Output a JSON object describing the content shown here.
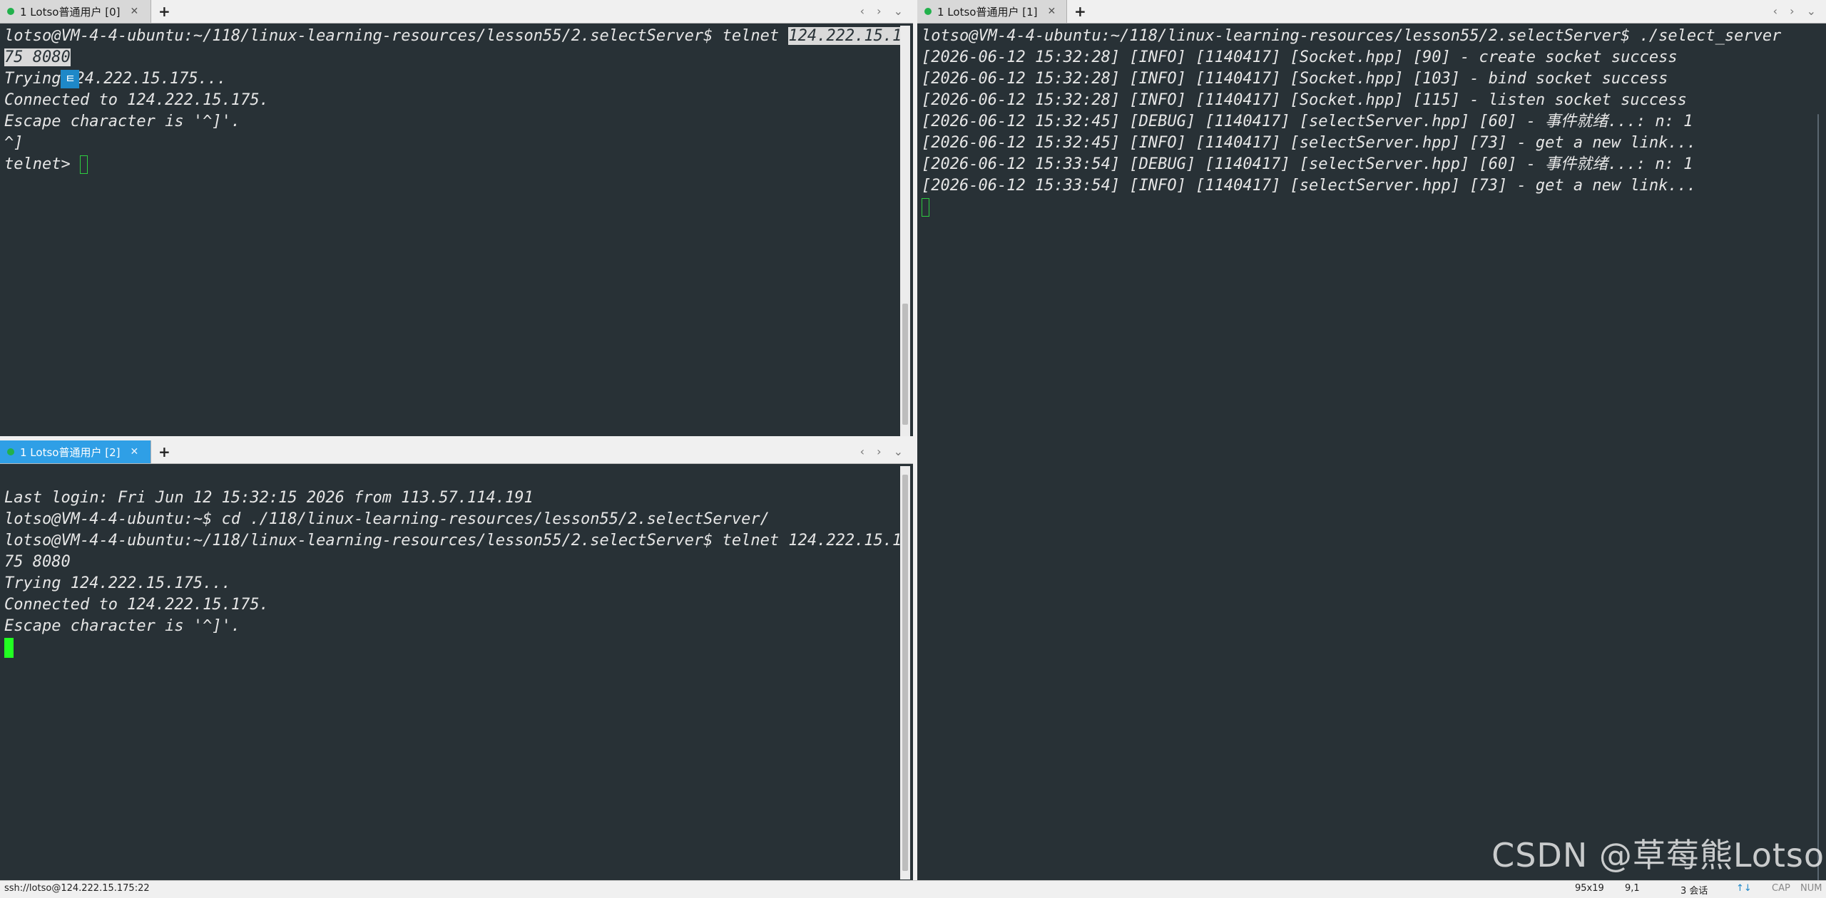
{
  "panes": {
    "top_left": {
      "tab_label": "1 Lotso普通用户 [0]",
      "lines": [
        {
          "pre": "lotso@VM-4-4-ubuntu:~/118/linux-learning-resources/lesson55/2.selectServer$ telnet ",
          "sel": "124.222.15.1"
        },
        {
          "sel": "75 8080"
        },
        {
          "pre": "Trying",
          "ime": "ㅌ",
          "post": "24.222.15.175..."
        },
        {
          "pre": "Connected to 124.222.15.175."
        },
        {
          "pre": "Escape character is '^]'."
        },
        {
          "pre": "^]"
        },
        {
          "pre": "telnet> ",
          "cursor": "outline"
        }
      ]
    },
    "bottom_left": {
      "tab_label": "1 Lotso普通用户 [2]",
      "lines": [
        {
          "pre": ""
        },
        {
          "pre": "Last login: Fri Jun 12 15:32:15 2026 from 113.57.114.191"
        },
        {
          "pre": "lotso@VM-4-4-ubuntu:~$ cd ./118/linux-learning-resources/lesson55/2.selectServer/"
        },
        {
          "pre": "lotso@VM-4-4-ubuntu:~/118/linux-learning-resources/lesson55/2.selectServer$ telnet 124.222.15.1"
        },
        {
          "pre": "75 8080"
        },
        {
          "pre": "Trying 124.222.15.175..."
        },
        {
          "pre": "Connected to 124.222.15.175."
        },
        {
          "pre": "Escape character is '^]'."
        },
        {
          "pre": "",
          "cursor": "solid"
        }
      ]
    },
    "right": {
      "tab_label": "1 Lotso普通用户 [1]",
      "lines": [
        {
          "pre": "lotso@VM-4-4-ubuntu:~/118/linux-learning-resources/lesson55/2.selectServer$ ./select_server"
        },
        {
          "pre": "[2026-06-12 15:32:28] [INFO] [1140417] [Socket.hpp] [90] - create socket success"
        },
        {
          "pre": "[2026-06-12 15:32:28] [INFO] [1140417] [Socket.hpp] [103] - bind socket success"
        },
        {
          "pre": "[2026-06-12 15:32:28] [INFO] [1140417] [Socket.hpp] [115] - listen socket success"
        },
        {
          "pre": "[2026-06-12 15:32:45] [DEBUG] [1140417] [selectServer.hpp] [60] - 事件就绪...: n: 1"
        },
        {
          "pre": "[2026-06-12 15:32:45] [INFO] [1140417] [selectServer.hpp] [73] - get a new link..."
        },
        {
          "pre": "[2026-06-12 15:33:54] [DEBUG] [1140417] [selectServer.hpp] [60] - 事件就绪...: n: 1"
        },
        {
          "pre": "[2026-06-12 15:33:54] [INFO] [1140417] [selectServer.hpp] [73] - get a new link..."
        },
        {
          "pre": "",
          "cursor": "outline"
        }
      ]
    }
  },
  "tabbar": {
    "add_tab": "+",
    "nav": "‹ › ⌄"
  },
  "statusbar": {
    "connection": "ssh://lotso@124.222.15.175:22",
    "size": "95x19",
    "position": "9,1",
    "sessions": "3 会话",
    "arrows": "↑↓",
    "cap": "CAP",
    "num": "NUM"
  },
  "watermark": "CSDN @草莓熊Lotso",
  "colors": {
    "terminal_bg": "#283136",
    "active_tab": "#2f9fe6",
    "cursor": "#22ff22"
  }
}
